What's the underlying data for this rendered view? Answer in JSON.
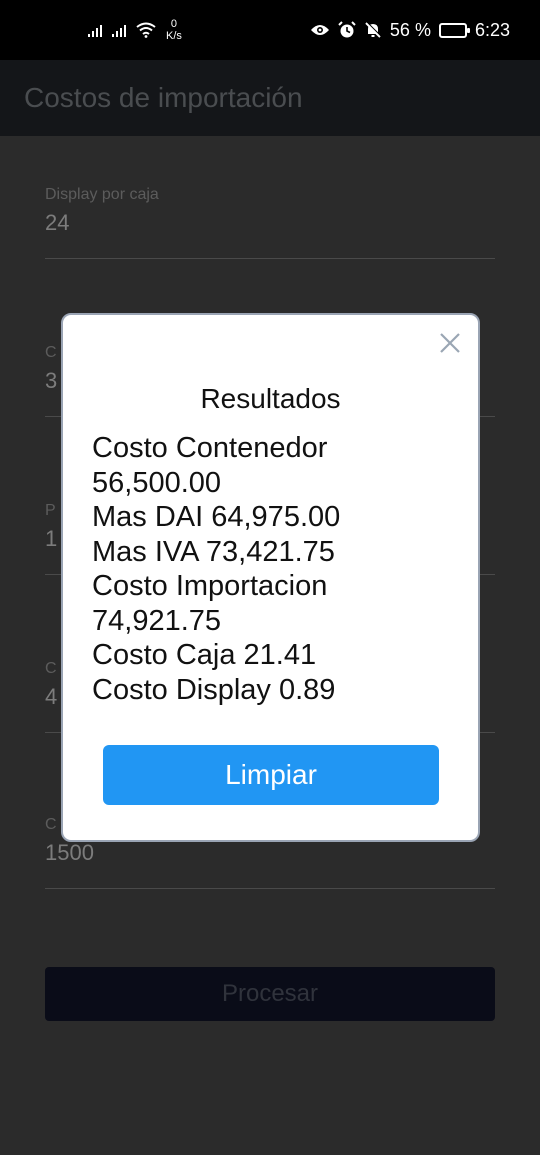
{
  "status_bar": {
    "net_speed_value": "0",
    "net_speed_unit": "K/s",
    "battery_percent": "56 %",
    "battery_level": 0.56,
    "time": "6:23"
  },
  "app_bar": {
    "title": "Costos de importación"
  },
  "form": {
    "fields": [
      {
        "label": "Display por caja",
        "value": "24"
      },
      {
        "label": "C",
        "value": "3"
      },
      {
        "label": "P",
        "value": "1"
      },
      {
        "label": "C",
        "value": "4"
      },
      {
        "label": "C",
        "value": "1500"
      }
    ],
    "submit_label": "Procesar"
  },
  "dialog": {
    "title": "Resultados",
    "lines": [
      "Costo Contenedor",
      "56,500.00",
      "Mas DAI 64,975.00",
      "Mas IVA 73,421.75",
      "Costo Importacion",
      "74,921.75",
      "Costo Caja 21.41",
      "Costo Display 0.89"
    ],
    "action_label": "Limpiar"
  }
}
